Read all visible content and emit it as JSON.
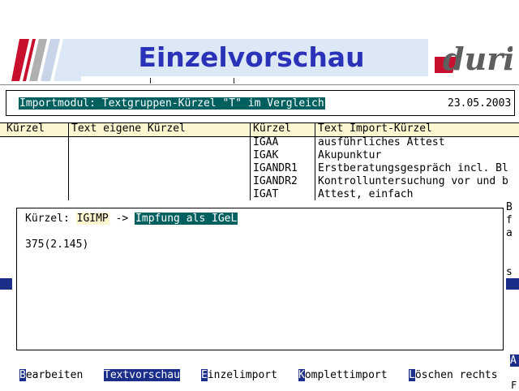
{
  "header": {
    "title": "Einzelvorschau",
    "brand": "duria"
  },
  "info": {
    "module_label": "Importmodul: Textgruppen-Kürzel \"T\" im Vergleich",
    "date": "23.05.2003"
  },
  "table": {
    "columns": [
      "Kürzel",
      "Text eigene Kürzel",
      "Kürzel",
      "Text Import-Kürzel"
    ],
    "rows": [
      {
        "code": "IGAA",
        "text": "ausführliches Attest"
      },
      {
        "code": "IGAK",
        "text": "Akupunktur"
      },
      {
        "code": "IGANDR1",
        "text": "Erstberatungsgespräch incl. Bl"
      },
      {
        "code": "IGANDR2",
        "text": "Kontrolluntersuchung vor und b"
      },
      {
        "code": "IGAT",
        "text": "Attest, einfach"
      }
    ]
  },
  "side": {
    "r1": "B",
    "r2": "f",
    "r3": "a",
    "r4": "s"
  },
  "detail": {
    "label": "Kürzel: ",
    "code": "IGIMP",
    "arrow": " -> ",
    "text": "Impfung als IGeL",
    "count": "375(2.145)"
  },
  "menu": [
    {
      "hot": "B",
      "rest": "earbeiten"
    },
    {
      "hot": "",
      "rest": "Textvorschau"
    },
    {
      "hot": "E",
      "rest": "inzelimport"
    },
    {
      "hot": "K",
      "rest": "omplettimport"
    },
    {
      "hot": "L",
      "rest": "öschen rechts"
    }
  ],
  "corner": {
    "a": "A",
    "f": "F"
  },
  "colors": {
    "title": "#2a33b8",
    "teal": "#005f5f",
    "navy": "#1a2e8a",
    "cream": "#fbf6cf"
  }
}
